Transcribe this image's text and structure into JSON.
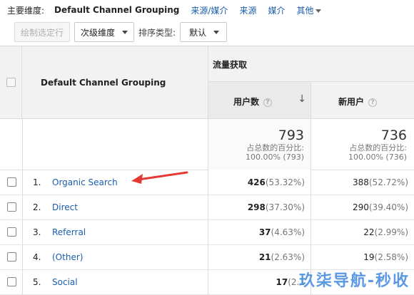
{
  "dimension_bar": {
    "label": "主要维度:",
    "primary": "Default Channel Grouping",
    "links": [
      "来源/媒介",
      "来源",
      "媒介",
      "其他"
    ]
  },
  "toolbar": {
    "plot_rows": "绘制选定行",
    "secondary_dimension": "次级维度",
    "sort_type_label": "排序类型:",
    "sort_type_value": "默认"
  },
  "table": {
    "header": {
      "dimension": "Default Channel Grouping",
      "group": "流量获取",
      "col1": "用户数",
      "col2": "新用户",
      "help_glyph": "?",
      "sort_glyph": "↓"
    },
    "totals": {
      "col1": {
        "value": "793",
        "label": "占总数的百分比:",
        "pct": "100.00% (793)"
      },
      "col2": {
        "value": "736",
        "label": "占总数的百分比:",
        "pct": "100.00% (736)"
      }
    },
    "rows": [
      {
        "num": "1.",
        "name": "Organic Search",
        "v1": "426",
        "p1": "(53.32%)",
        "v2": "388",
        "p2": "(52.72%)"
      },
      {
        "num": "2.",
        "name": "Direct",
        "v1": "298",
        "p1": "(37.30%)",
        "v2": "290",
        "p2": "(39.40%)"
      },
      {
        "num": "3.",
        "name": "Referral",
        "v1": "37",
        "p1": "(4.63%)",
        "v2": "22",
        "p2": "(2.99%)"
      },
      {
        "num": "4.",
        "name": "(Other)",
        "v1": "21",
        "p1": "(2.63%)",
        "v2": "19",
        "p2": "(2.58%)"
      },
      {
        "num": "5.",
        "name": "Social",
        "v1": "17",
        "p1": "(2.1",
        "v2": "",
        "p2": ""
      }
    ]
  },
  "watermark": "玖柒导航-秒收",
  "colors": {
    "link": "#1a5dad",
    "arrow": "#e53935",
    "header_bg": "#f2f2f2"
  }
}
